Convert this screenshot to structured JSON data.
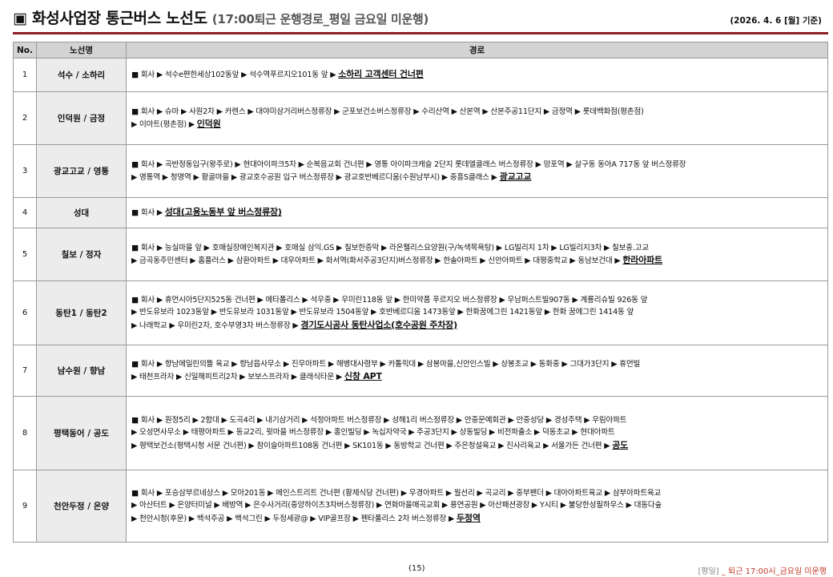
{
  "header": {
    "title": "▣ 화성사업장 통근버스 노선도",
    "subtitle": "(17:00퇴근 운행경로_평일 금요일 미운행)",
    "date": "(2026. 4. 6 [월] 기준)"
  },
  "table": {
    "headers": [
      "No.",
      "노선명",
      "경로"
    ],
    "rows": [
      {
        "no": "1",
        "name": "석수 / 소하리",
        "route_lines": [
          "■ 회사 ▶ 석수e편한세상102동앞 ▶ 석수역푸르지오101동 앞 ▶"
        ],
        "destination": "소하리 고객센터 건너편"
      },
      {
        "no": "2",
        "name": "인덕원 / 금정",
        "route_lines": [
          "■ 회사 ▶ 슈마 ▶ 사원2차 ▶ 카렌스 ▶ 대야미삼거리버스정류장 ▶ 군포보건소버스정류장 ▶ 수리산역 ▶ 산본역 ▶ 산본주공11단지 ▶ 금정역 ▶ 롯데백화점(평촌점)",
          "▶ 이마트(평촌점) ▶"
        ],
        "destination": "인덕원"
      },
      {
        "no": "3",
        "name": "광교고교 / 영통",
        "route_lines": [
          "■ 회사 ▶ 곡반정동입구(왕주로) ▶ 현대아이파크5차 ▶ 순복음교회 건너편 ▶ 영통 아이파크캐슬 2단지 롯데엘클래스 버스정류장 ▶ 망포역 ▶ 살구동 동아A 717동 앞 버스정류장",
          "▶ 영통역 ▶ 청명역 ▶ 황골마을 ▶ 광교호수공원 입구 버스정류장 ▶ 광교호반베르디움(수원남부시) ▶ 중흥S클래스 ▶"
        ],
        "destination": "광교고교"
      },
      {
        "no": "4",
        "name": "성대",
        "route_lines": [
          "■ 회사 ▶"
        ],
        "destination": "성대(고용노동부 앞 버스정류장)"
      },
      {
        "no": "5",
        "name": "칠보 / 정자",
        "route_lines": [
          "■ 회사 ▶ 능실마을 앞 ▶ 호매실장애인복지관 ▶ 호매실 삼익.GS ▶ 칠보한증막 ▶ 라온펠리스요양원(구/녹색목욕탕) ▶ LG빌리지 1차 ▶ LG빌리지3차 ▶ 칠보중.고교",
          "▶ 금곡동주민센터 ▶ 홈플러스 ▶ 삼환아파트 ▶ 대우아파트 ▶ 화서역(화서주공3단지)버스정류장 ▶ 한솔아파트 ▶ 신안아파트 ▶ 대평중학교 ▶ 동남보건대 ▶"
        ],
        "destination": "한라아파트"
      },
      {
        "no": "6",
        "name": "동탄1 / 동탄2",
        "route_lines": [
          "■ 회사 ▶ 휴먼시아5단지525동 건너편 ▶ 메타폴리스 ▶ 석우중 ▶ 우미린118동 앞 ▶ 한미약품 푸르지오 버스정류장 ▶ 우남퍼스트빌907동 ▶ 계룡리슈빌 926동 앞",
          "▶ 반도유보라 1023동앞 ▶ 반도유보라 1031동앞 ▶ 반도유보라 1504동앞 ▶ 호반베르디움 1473동앞 ▶ 한화꿈에그린 1421동앞 ▶ 한화 꿈에그린 1414동 앞",
          "▶ 나래학교 ▶ 우미린2차, 호수부영3차 버스정류장 ▶"
        ],
        "destination": "경기도시공사 동탄사업소(호수공원 주차장)"
      },
      {
        "no": "7",
        "name": "남수원 / 향남",
        "route_lines": [
          "■ 회사 ▶ 향남에일린의뜰 육교 ▶ 향남읍사무소 ▶ 진우아파트 ▶ 해병대사령부 ▶ 카톨릭대 ▶ 삼봉마을,신안인스빌 ▶ 상봉초교 ▶ 동화중 ▶ 그대가3단지 ▶ 휴먼빌",
          "▶ 태천프라자 ▶ 신일해피트리2차 ▶ 보보스프라자 ▶ 클래식타운 ▶"
        ],
        "destination": "신창 APT"
      },
      {
        "no": "8",
        "name": "평택동어 / 공도",
        "route_lines": [
          "■ 회사 ▶ 원정5리 ▶ 2함대 ▶ 도곡4리 ▶ 내기삼거리 ▶ 석정아파트 버스정류장 ▶ 성해1리 버스정류장 ▶ 안중문예회관 ▶ 안중성당 ▶ 경성주택 ▶ 우림아파트",
          "▶ 오성면사무소 ▶ 태평아파트 ▶ 동교2리, 윗마을 버스정류장 ▶ 홍인빌딩 ▶ 녹십자약국 ▶ 주공3단지 ▶ 상동빌딩 ▶ 비전파출소 ▶ 덕동초교 ▶ 현대아파트",
          "▶ 평택보건소(평택시청 서문 건너편) ▶ 참이슬아파트108동 건너편 ▶ SK101동 ▶ 동방학교 건너편 ▶ 주은청설육교 ▶ 진사리육교 ▶ 서울가든 건너편 ▶"
        ],
        "destination": "공도"
      },
      {
        "no": "9",
        "name": "천안두정 / 온양",
        "route_lines": [
          "■ 회사 ▶ 포승삼부르네상스 ▶ 모아201동 ▶ 메인스트리트 건너편 (황제식당 건너편) ▶ 우경아파트 ▶ 월선리 ▶ 곡교리 ▶ 중부팬더 ▶ 대아아파트육교 ▶ 삼부아파트육교",
          "▶ 아산터트 ▶ 온양터미널 ▶ 배방역 ▶ 은수사거리(중앙하이츠3차버스정류장) ▶ 연화마을매곡교회 ▶ 용연공원 ▶ 아산패션광장 ▶ Y시티 ▶ 불당한성필하우스 ▶ 대동다숲",
          "▶ 천안시청(후문) ▶ 백석주공 ▶ 백석그린 ▶ 두정세광@ ▶ VIP골프장 ▶ 펜타폴리스 2차 버스정류장 ▶"
        ],
        "destination": "두정역"
      }
    ]
  },
  "footer": {
    "page": "(15)",
    "note_tag": "[평일]",
    "note": " _ 퇴근 17:00시_금요일 미운행"
  }
}
